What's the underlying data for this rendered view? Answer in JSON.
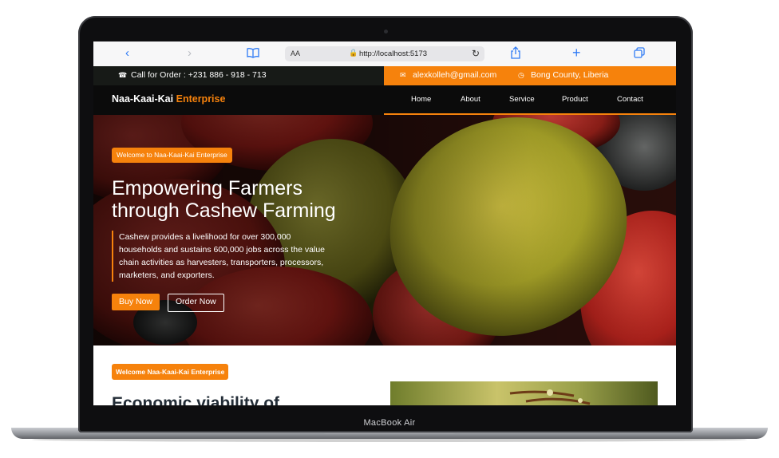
{
  "device": {
    "model": "MacBook Air"
  },
  "browser": {
    "address_prefix": "AA",
    "url": "http://localhost:5173"
  },
  "topbar": {
    "phone": "Call for Order : +231 886 - 918 - 713",
    "email": "alexkolleh@gmail.com",
    "location": "Bong County, Liberia"
  },
  "nav": {
    "brand_main": "Naa-Kaai-Kai",
    "brand_accent": "Enterprise",
    "links": [
      "Home",
      "About",
      "Service",
      "Product",
      "Contact"
    ]
  },
  "hero": {
    "badge": "Welcome to Naa-Kaai-Kai Enterprise",
    "title_line1": "Empowering Farmers",
    "title_line2": "through Cashew Farming",
    "quote": "Cashew provides a livelihood for over 300,000 households and sustains 600,000 jobs across the value chain activities as harvesters, transporters, processors, marketers, and exporters.",
    "btn_primary": "Buy Now",
    "btn_secondary": "Order Now"
  },
  "section": {
    "badge": "Welcome Naa-Kaai-Kai Enterprise",
    "heading": "Economic viability of"
  },
  "colors": {
    "accent": "#f6820c",
    "dark": "#0b0b0b",
    "topbar_dark": "#171a17"
  },
  "icons": [
    "back-icon",
    "forward-icon",
    "bookmarks-icon",
    "lock-icon",
    "reload-icon",
    "share-icon",
    "new-tab-icon",
    "tabs-icon",
    "phone-icon",
    "mail-icon",
    "clock-icon"
  ]
}
